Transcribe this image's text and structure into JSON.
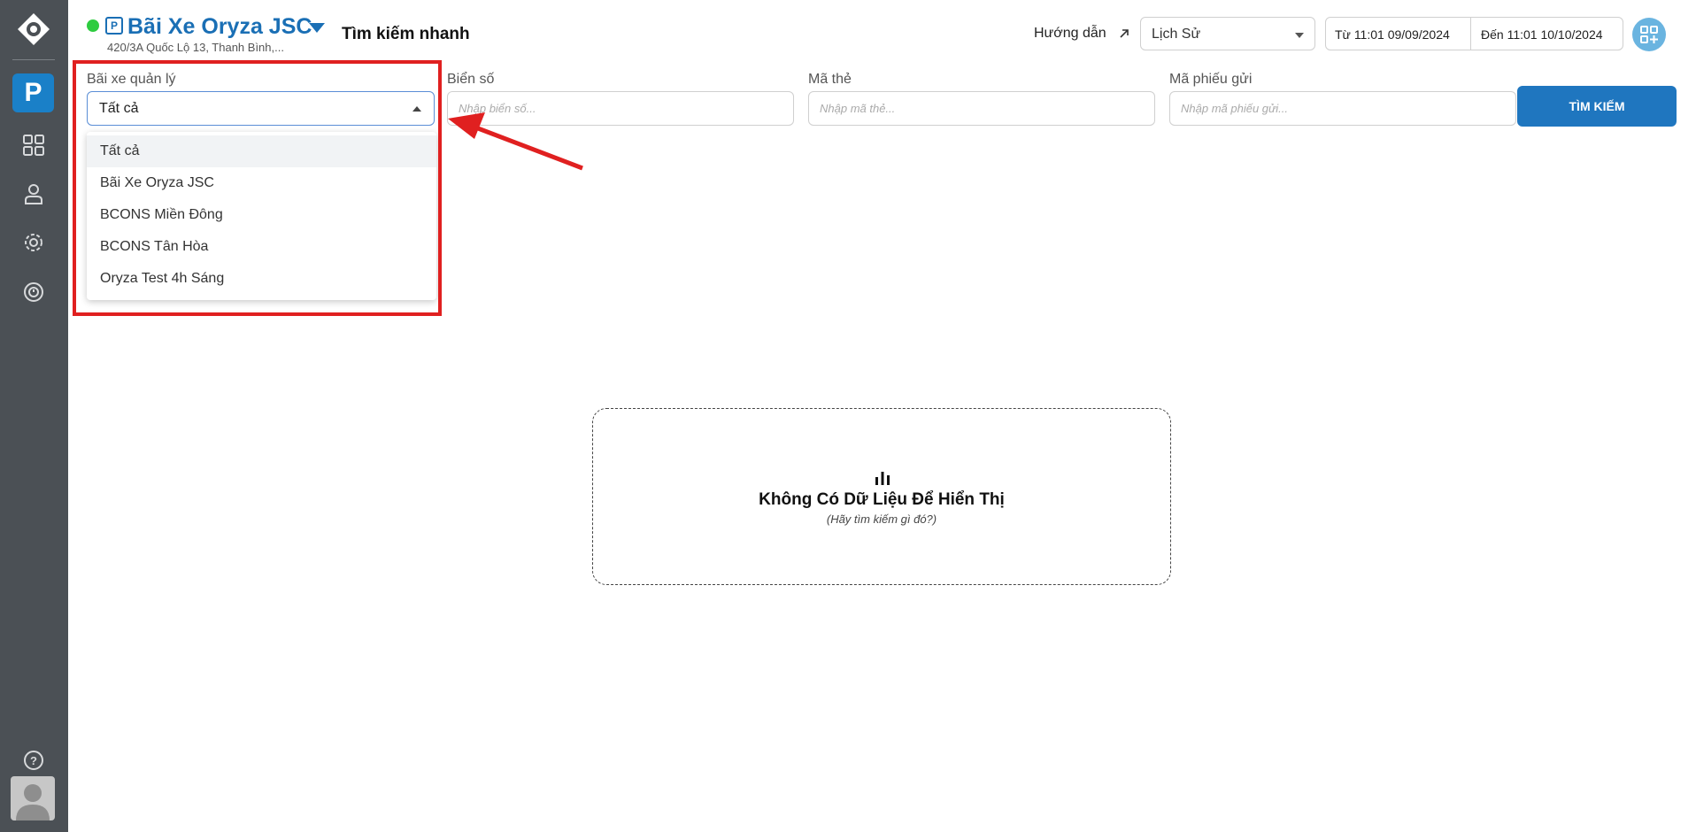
{
  "header": {
    "lot_name": "Bãi Xe Oryza JSC",
    "lot_address": "420/3A Quốc Lộ 13, Thanh Bình,...",
    "page_title": "Tìm kiếm nhanh",
    "guide_label": "Hướng dẫn",
    "history_select": "Lịch Sử",
    "date_from": "Từ 11:01 09/09/2024",
    "date_to": "Đến 11:01 10/10/2024"
  },
  "sidebar": {
    "active_badge": "P",
    "items": [
      "dashboard-grid-icon",
      "user-icon",
      "settings-gear-icon",
      "history-icon"
    ],
    "bottom": [
      "help-icon",
      "avatar"
    ]
  },
  "filters": {
    "lot_label": "Bãi xe quản lý",
    "lot_value": "Tất cả",
    "plate_label": "Biển số",
    "plate_placeholder": "Nhập biển số...",
    "card_label": "Mã thẻ",
    "card_placeholder": "Nhập mã thẻ...",
    "ticket_label": "Mã phiếu gửi",
    "ticket_placeholder": "Nhập mã phiếu gửi...",
    "search_button": "TÌM KIẾM"
  },
  "dropdown": {
    "options": [
      "Tất cả",
      "Bãi Xe Oryza JSC",
      "BCONS Miền Đông",
      "BCONS Tân Hòa",
      "Oryza Test 4h Sáng"
    ],
    "selected_index": 0
  },
  "empty_state": {
    "title": "Không Có Dữ Liệu Để Hiển Thị",
    "subtitle": "(Hãy tìm kiếm gì đó?)"
  },
  "colors": {
    "sidebar_bg": "#4b5055",
    "accent": "#1a80c8",
    "status_online": "#2ecc40",
    "annotation": "#e02020"
  }
}
